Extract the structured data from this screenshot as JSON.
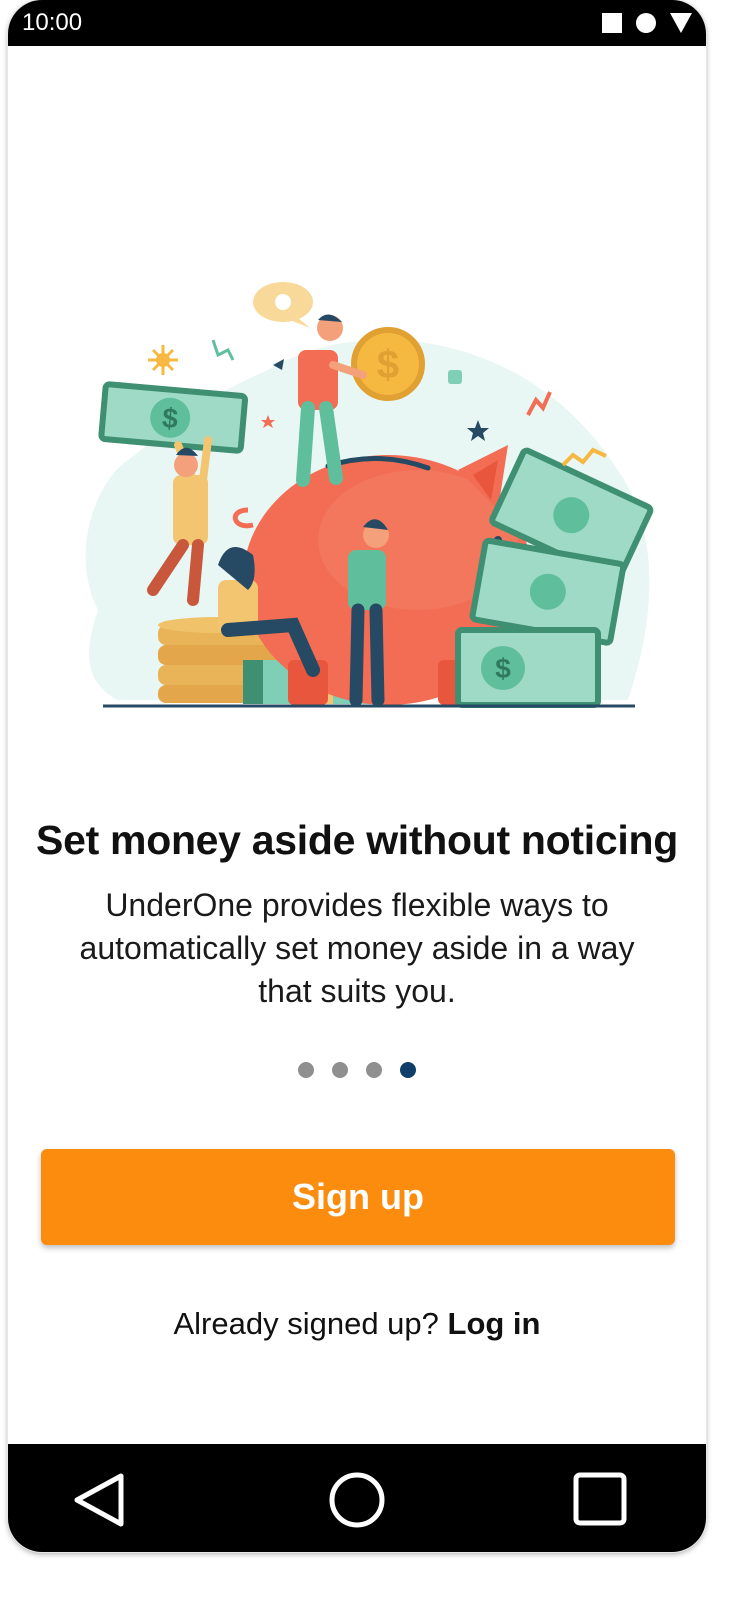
{
  "status_bar": {
    "time": "10:00",
    "icons": [
      "square-icon",
      "circle-icon",
      "triangle-icon"
    ]
  },
  "onboarding": {
    "illustration": "piggy-bank-savings-illustration",
    "headline": "Set money aside without noticing",
    "description": "UnderOne provides flexible ways to automatically set money aside in a way that suits you.",
    "pagination": {
      "total": 4,
      "active_index": 3
    }
  },
  "actions": {
    "signup_label": "Sign up",
    "login_prompt": "Already signed up? ",
    "login_label": "Log in"
  },
  "nav_bar": {
    "buttons": [
      "back-icon",
      "home-icon",
      "recents-icon"
    ]
  },
  "colors": {
    "accent": "#fb8c0e",
    "active_dot": "#0f3e6b",
    "inactive_dot": "#8f8f8f",
    "text": "#111111"
  }
}
